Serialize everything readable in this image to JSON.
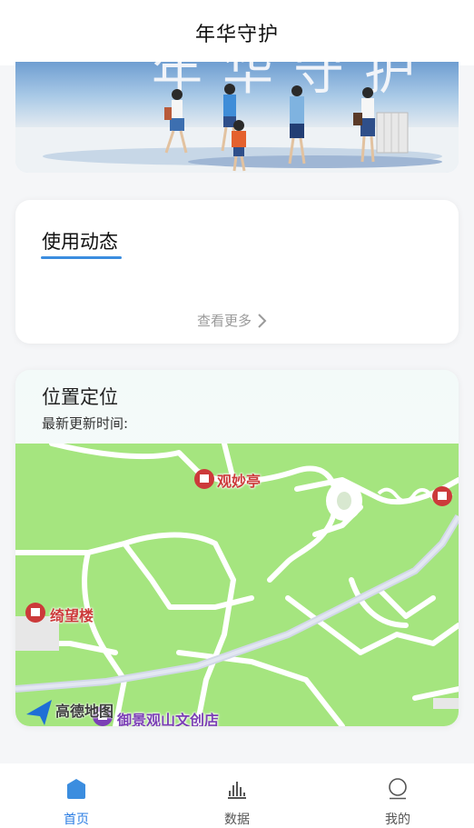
{
  "header": {
    "title": "年华守护"
  },
  "banner": {
    "text": "年华守护"
  },
  "usage_card": {
    "title": "使用动态",
    "more_label": "查看更多"
  },
  "location_card": {
    "title": "位置定位",
    "update_label": "最新更新时间:",
    "map": {
      "pois": [
        {
          "name": "观妙亭"
        },
        {
          "name": "绮望楼"
        },
        {
          "name": "御景观山文创店"
        }
      ],
      "logo": "高德地图"
    }
  },
  "tabbar": {
    "tabs": [
      {
        "label": "首页",
        "icon": "home-icon",
        "active": true
      },
      {
        "label": "数据",
        "icon": "bar-chart-icon",
        "active": false
      },
      {
        "label": "我的",
        "icon": "profile-icon",
        "active": false
      }
    ],
    "active_color": "#2b7de3"
  }
}
